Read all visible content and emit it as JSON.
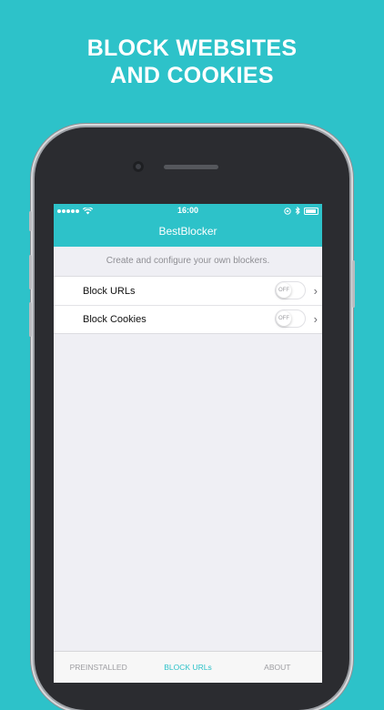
{
  "headline": {
    "line1": "BLOCK WEBSITES",
    "line2": "AND COOKIES"
  },
  "statusbar": {
    "time": "16:00"
  },
  "app": {
    "title": "BestBlocker",
    "subtitle": "Create and configure your own blockers."
  },
  "blockers": [
    {
      "label": "Block URLs",
      "toggle_text": "OFF",
      "enabled": false
    },
    {
      "label": "Block Cookies",
      "toggle_text": "OFF",
      "enabled": false
    }
  ],
  "tabs": [
    {
      "label": "PREINSTALLED",
      "active": false
    },
    {
      "label": "BLOCK URLs",
      "active": true
    },
    {
      "label": "ABOUT",
      "active": false
    }
  ],
  "colors": {
    "accent": "#2dc2c9",
    "background": "#efeff4"
  }
}
